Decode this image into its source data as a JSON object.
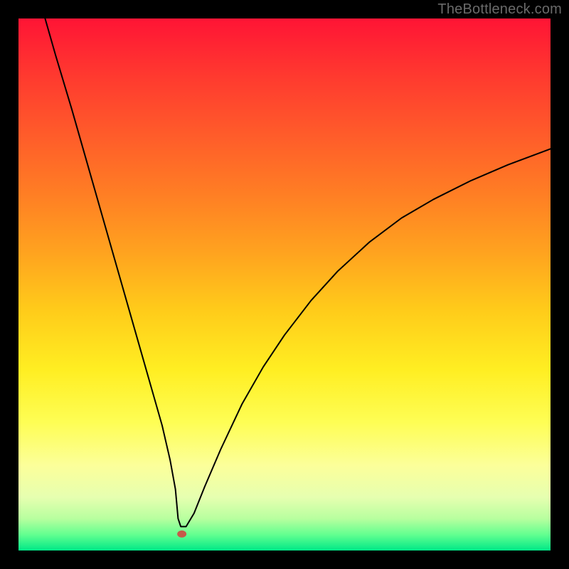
{
  "watermark": "TheBottleneck.com",
  "chart_data": {
    "type": "line",
    "title": "",
    "xlabel": "",
    "ylabel": "",
    "xlim": [
      0,
      100
    ],
    "ylim": [
      0,
      100
    ],
    "grid": false,
    "gradient_note": "vertical rainbow background from red (top) through orange, yellow, pale yellow to green (bottom)",
    "series": [
      {
        "name": "curve",
        "x": [
          5,
          7,
          10,
          13,
          16,
          19,
          22,
          25,
          27,
          28.5,
          29.5,
          30,
          30.5,
          31.5,
          33,
          35,
          38,
          42,
          46,
          50,
          55,
          60,
          66,
          72,
          78,
          85,
          92,
          100
        ],
        "values": [
          100,
          93,
          83,
          72.5,
          62,
          51.5,
          41,
          30.5,
          23.5,
          17,
          11.5,
          6,
          4.5,
          4.5,
          7,
          12,
          19,
          27.5,
          34.5,
          40.5,
          47,
          52.5,
          58,
          62.5,
          66,
          69.5,
          72.5,
          75.5
        ]
      }
    ],
    "marker": {
      "x": 30.7,
      "y": 3.1,
      "color": "#c65a4a"
    },
    "background_colors_top_to_bottom": [
      "#ff1435",
      "#ff7e24",
      "#ffee22",
      "#fcff9a",
      "#00e887"
    ]
  }
}
